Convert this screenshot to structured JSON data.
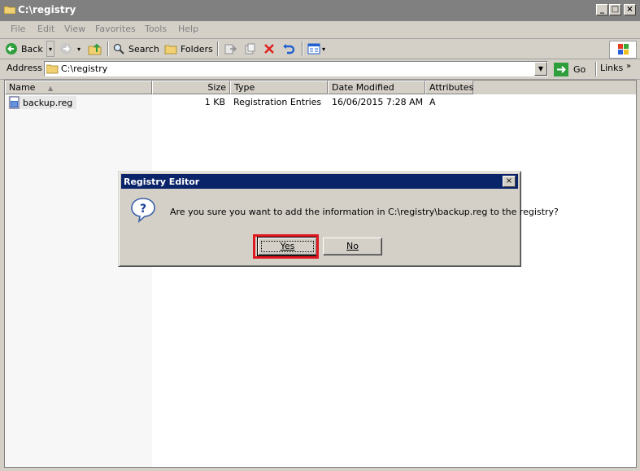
{
  "window": {
    "title": "C:\\registry",
    "buttons": {
      "minimize": "_",
      "maximize": "□",
      "close": "×"
    }
  },
  "menu": [
    "File",
    "Edit",
    "View",
    "Favorites",
    "Tools",
    "Help"
  ],
  "toolbar": {
    "back": "Back",
    "search": "Search",
    "folders": "Folders"
  },
  "address": {
    "label": "Address",
    "value": "C:\\registry",
    "go": "Go",
    "links": "Links"
  },
  "columns": [
    "Name",
    "Size",
    "Type",
    "Date Modified",
    "Attributes"
  ],
  "files": [
    {
      "name": "backup.reg",
      "size": "1 KB",
      "type": "Registration Entries",
      "modified": "16/06/2015 7:28 AM",
      "attributes": "A"
    }
  ],
  "dialog": {
    "title": "Registry Editor",
    "message": "Are you sure you want to add the information in C:\\registry\\backup.reg to the registry?",
    "yes": "Yes",
    "no": "No",
    "close": "×"
  },
  "colors": {
    "dialog_title_bg": "#0a246a",
    "inactive_title_bg": "#808080",
    "highlight": "#e01820"
  }
}
